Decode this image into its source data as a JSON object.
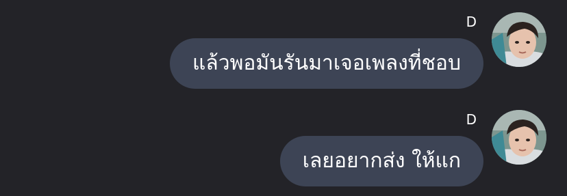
{
  "messages": [
    {
      "sender": "D",
      "text": "แล้วพอมันรันมาเจอเพลงที่ชอบ",
      "avatar_icon": "user-photo-avatar"
    },
    {
      "sender": "D",
      "text": "เลยอยากส่ง ให้แก",
      "avatar_icon": "user-photo-avatar"
    }
  ],
  "colors": {
    "background": "#232328",
    "bubble": "#3d4455",
    "text": "#ffffff"
  }
}
